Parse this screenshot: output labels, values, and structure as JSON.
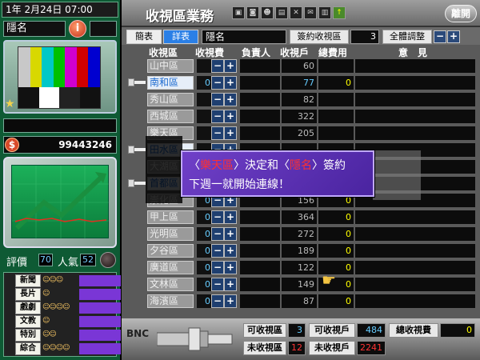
{
  "status": {
    "date": "1年  2月24日  07:00",
    "player_name": "隱名",
    "info_icon": "i",
    "money": "99443246"
  },
  "left": {
    "rating_label": "評價",
    "rating_value": "70",
    "popularity_label": "人氣",
    "popularity_value": "52",
    "genres": [
      "新聞",
      "長片",
      "戲劇",
      "文教",
      "特別",
      "綜合"
    ]
  },
  "header": {
    "title": "收視區業務",
    "leave": "離開"
  },
  "toolbar": {
    "tab_simple": "簡表",
    "tab_detail": "詳表",
    "selected_district": "隱名",
    "signed_label": "簽約收視區",
    "signed_value": "3",
    "adjust_label": "全體調整",
    "minus": "−",
    "plus": "+"
  },
  "table": {
    "columns": {
      "district": "收視區",
      "fee": "收視費",
      "manager": "負責人",
      "households": "收視戶",
      "total_fee": "總費用",
      "opinion": "意　見"
    },
    "rows": [
      {
        "name": "山中區",
        "fee": "",
        "households": "60",
        "total": "",
        "signed": false
      },
      {
        "name": "南和區",
        "fee": "0",
        "households": "77",
        "total": "0",
        "signed": true
      },
      {
        "name": "秀山區",
        "fee": "",
        "households": "82",
        "total": "",
        "signed": false
      },
      {
        "name": "西城區",
        "fee": "",
        "households": "322",
        "total": "",
        "signed": false
      },
      {
        "name": "樂天區",
        "fee": "",
        "households": "205",
        "total": "",
        "signed": false
      },
      {
        "name": "田水區",
        "fee": "",
        "households": "",
        "total": "",
        "signed": true
      },
      {
        "name": "大湖區",
        "fee": "",
        "households": "",
        "total": "",
        "signed": false
      },
      {
        "name": "首都區",
        "fee": "",
        "households": "",
        "total": "",
        "signed": true
      },
      {
        "name": "崇化區",
        "fee": "0",
        "households": "156",
        "total": "0",
        "signed": false
      },
      {
        "name": "甲上區",
        "fee": "0",
        "households": "364",
        "total": "0",
        "signed": false
      },
      {
        "name": "光明區",
        "fee": "0",
        "households": "272",
        "total": "0",
        "signed": false
      },
      {
        "name": "夕谷區",
        "fee": "0",
        "households": "189",
        "total": "0",
        "signed": false
      },
      {
        "name": "廣道區",
        "fee": "0",
        "households": "122",
        "total": "0",
        "signed": false
      },
      {
        "name": "文林區",
        "fee": "0",
        "households": "149",
        "total": "0",
        "signed": false
      },
      {
        "name": "海濱區",
        "fee": "0",
        "households": "87",
        "total": "0",
        "signed": false
      }
    ]
  },
  "popup": {
    "bracket_open": "〈",
    "bracket_close": "〉",
    "district": "樂天區",
    "middle": "決定和",
    "company": "隱名",
    "end": "簽約",
    "line2": "下週一就開始連線！"
  },
  "bottom": {
    "bnc": "BNC",
    "avail_district_label": "可收視區",
    "avail_district_value": "3",
    "avail_household_label": "可收視戶",
    "avail_household_value": "484",
    "total_fee_label": "總收視費",
    "total_fee_value": "0",
    "unavail_district_label": "未收視區",
    "unavail_district_value": "12",
    "unavail_household_label": "未收視戶",
    "unavail_household_value": "2241"
  }
}
